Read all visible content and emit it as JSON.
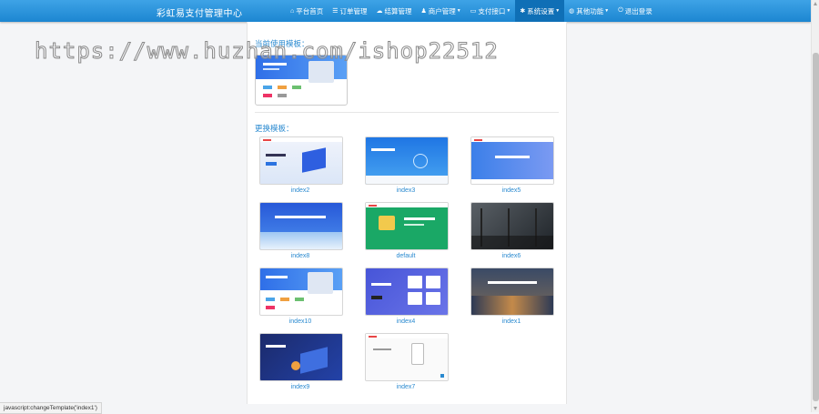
{
  "brand": "彩虹易支付管理中心",
  "nav": [
    {
      "icon": "home-icon",
      "glyph": "⌂",
      "label": "平台首页",
      "caret": false,
      "active": false
    },
    {
      "icon": "list-icon",
      "glyph": "☰",
      "label": "订单管理",
      "caret": false,
      "active": false
    },
    {
      "icon": "cloud-icon",
      "glyph": "☁",
      "label": "结算管理",
      "caret": false,
      "active": false
    },
    {
      "icon": "user-icon",
      "glyph": "♟",
      "label": "商户管理",
      "caret": true,
      "active": false
    },
    {
      "icon": "card-icon",
      "glyph": "▭",
      "label": "支付接口",
      "caret": true,
      "active": false
    },
    {
      "icon": "gear-icon",
      "glyph": "✱",
      "label": "系统设置",
      "caret": true,
      "active": true
    },
    {
      "icon": "globe-icon",
      "glyph": "◍",
      "label": "其他功能",
      "caret": true,
      "active": false
    },
    {
      "icon": "power-icon",
      "glyph": "⏻",
      "label": "退出登录",
      "caret": false,
      "active": false
    }
  ],
  "current_section": {
    "title": "当前使用模板："
  },
  "change_section": {
    "title": "更换模板："
  },
  "templates": [
    {
      "name": "index2"
    },
    {
      "name": "index3"
    },
    {
      "name": "index5"
    },
    {
      "name": "index8"
    },
    {
      "name": "default"
    },
    {
      "name": "index6"
    },
    {
      "name": "index10"
    },
    {
      "name": "index4"
    },
    {
      "name": "index1"
    },
    {
      "name": "index9"
    },
    {
      "name": "index7"
    }
  ],
  "watermark": "https://www.huzhan.com/ishop22512",
  "status_url": "javascript:changeTemplate('index1')"
}
